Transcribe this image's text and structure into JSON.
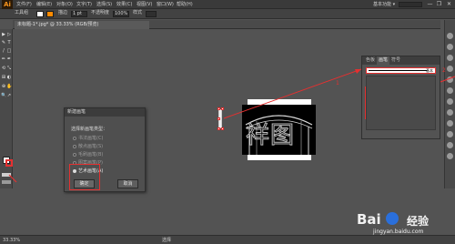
{
  "menubar": {
    "logo": "Ai",
    "items": [
      "文件(F)",
      "编辑(E)",
      "对象(O)",
      "文字(T)",
      "选择(S)",
      "效果(C)",
      "视图(V)",
      "窗口(W)",
      "帮助(H)"
    ],
    "workspace": "基本功能 ▾",
    "window_controls": [
      "—",
      "❐",
      "✕"
    ]
  },
  "controlbar": {
    "group_label": "工具组",
    "stroke_label": "描边",
    "stroke_value": "1 pt",
    "opacity_label": "不透明度",
    "opacity_value": "100%",
    "style_label": "样式",
    "stroke_color": "#ff8a00",
    "fill_color": "#ffffff"
  },
  "document": {
    "tab_title": "未标题-1*.jpg* @ 33.33% (RGB/预览)"
  },
  "toolbar": {
    "tools": [
      "▶",
      "▷",
      "✎",
      "T",
      "/",
      "□",
      "✏",
      "✒",
      "⟲",
      "⤡",
      "⊞",
      "◐",
      "⊕",
      "✋",
      "🔍",
      "↗"
    ]
  },
  "canvas": {
    "watermark_text": "祥图"
  },
  "dialog": {
    "title": "新建画笔",
    "prompt": "选择新画笔类型：",
    "options": [
      {
        "label": "书法画笔(C)",
        "selected": false
      },
      {
        "label": "散点画笔(S)",
        "selected": false
      },
      {
        "label": "毛刷画笔(B)",
        "selected": false
      },
      {
        "label": "图案画笔(P)",
        "selected": false
      },
      {
        "label": "艺术画笔(A)",
        "selected": true
      }
    ],
    "ok_label": "确定",
    "cancel_label": "取消"
  },
  "brush_panel": {
    "tabs": [
      "色板",
      "画笔",
      "符号"
    ],
    "active_tab": 1,
    "brush_name": "基本"
  },
  "annotations": {
    "step1": "1",
    "step2": "2",
    "color": "#e53030"
  },
  "statusbar": {
    "zoom": "33.33%",
    "status": "选择"
  },
  "watermark": {
    "brand": "Bai",
    "brand_suffix": "经验",
    "url": "jingyan.baidu.com"
  }
}
